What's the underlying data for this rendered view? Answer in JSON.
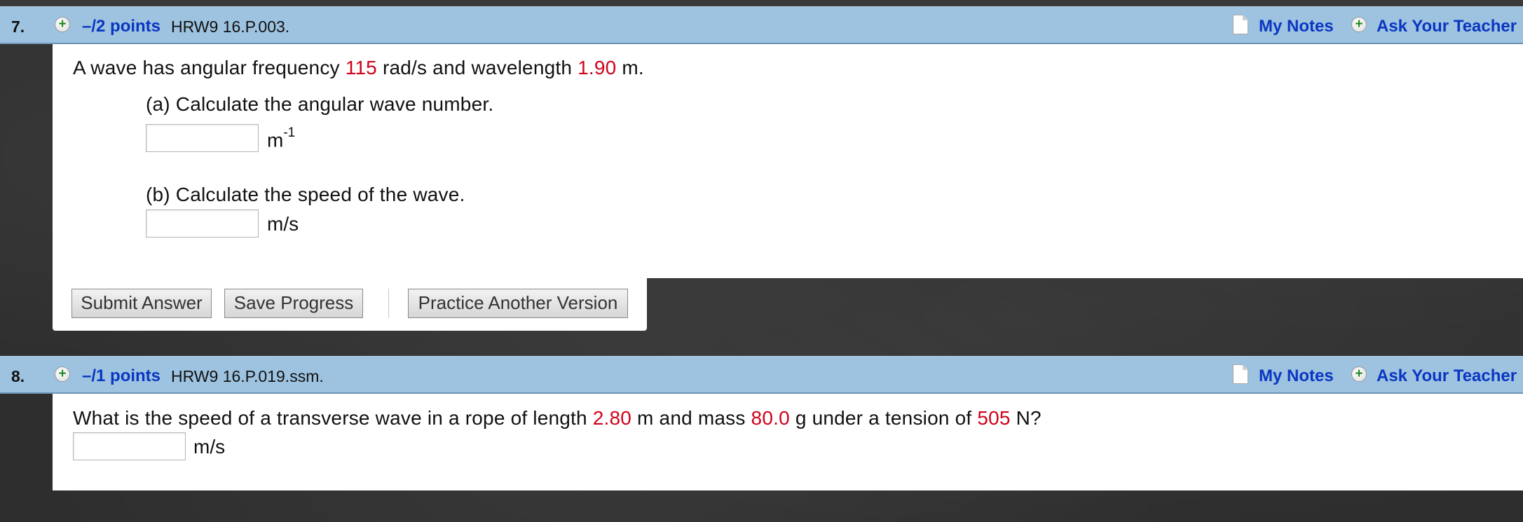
{
  "q7": {
    "number": "7.",
    "points": "–/2 points",
    "code": "HRW9 16.P.003.",
    "my_notes": "My Notes",
    "ask_teacher": "Ask Your Teacher",
    "intro": {
      "t1": "A wave has angular frequency ",
      "v1": "115",
      "t2": " rad/s and wavelength ",
      "v2": "1.90",
      "t3": " m."
    },
    "part_a": {
      "label": "(a) Calculate the angular wave number.",
      "unit_base": "m",
      "unit_exp": "-1",
      "value": ""
    },
    "part_b": {
      "label": "(b) Calculate the speed of the wave.",
      "unit": "m/s",
      "value": ""
    },
    "buttons": {
      "submit": "Submit Answer",
      "save": "Save Progress",
      "practice": "Practice Another Version"
    }
  },
  "q8": {
    "number": "8.",
    "points": "–/1 points",
    "code": "HRW9 16.P.019.ssm.",
    "my_notes": "My Notes",
    "ask_teacher": "Ask Your Teacher",
    "question": {
      "t1": "What is the speed of a transverse wave in a rope of length ",
      "v1": "2.80",
      "t2": " m and mass ",
      "v2": "80.0",
      "t3": " g under a tension of ",
      "v3": "505",
      "t4": " N?"
    },
    "unit": "m/s",
    "value": ""
  },
  "icons": {
    "plus": "+",
    "plus_color": "#1f8a1f",
    "link_color": "#0a36c2",
    "value_color": "#d0021b",
    "header_color": "#9dc3e0"
  }
}
